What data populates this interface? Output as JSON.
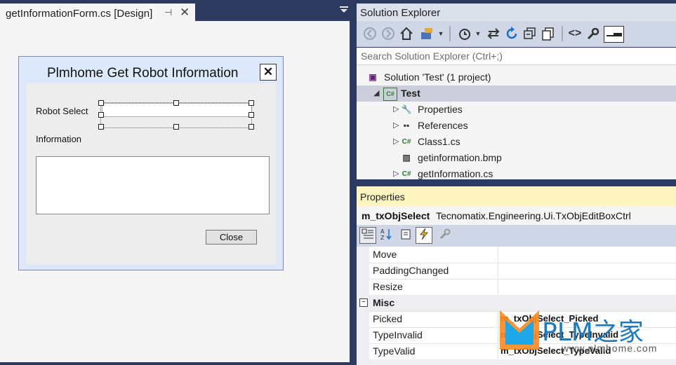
{
  "designer": {
    "tab_title": "getInformationForm.cs [Design]",
    "pin_glyph": "⊣",
    "close_glyph": "✕",
    "form": {
      "title": "Plmhome Get Robot Information",
      "close_glyph": "✕",
      "robot_select_label": "Robot Select",
      "information_label": "Information",
      "close_button": "Close"
    }
  },
  "solution_explorer": {
    "title": "Solution Explorer",
    "search_placeholder": "Search Solution Explorer (Ctrl+;)",
    "toolbar_icons": [
      "back-icon",
      "forward-icon",
      "home-icon",
      "sync-view-icon",
      "dropdown-icon",
      "pending-changes-icon",
      "dropdown-icon",
      "sync-icon",
      "refresh-icon",
      "collapse-all-icon",
      "show-all-files-icon",
      "view-code-icon",
      "properties-wrench-icon",
      "preview-icon"
    ],
    "tree": [
      {
        "label": "Solution 'Test' (1 project)",
        "icon": "solution-icon",
        "level": 0,
        "arrow": ""
      },
      {
        "label": "Test",
        "icon": "csharp-project-icon",
        "level": 1,
        "arrow": "expanded",
        "selected": true,
        "bold": true
      },
      {
        "label": "Properties",
        "icon": "wrench-icon",
        "level": 2,
        "arrow": "collapsed"
      },
      {
        "label": "References",
        "icon": "references-icon",
        "level": 2,
        "arrow": "collapsed"
      },
      {
        "label": "Class1.cs",
        "icon": "csharp-file-icon",
        "level": 2,
        "arrow": "collapsed"
      },
      {
        "label": "getinformation.bmp",
        "icon": "image-file-icon",
        "level": 2,
        "arrow": ""
      },
      {
        "label": "getInformation.cs",
        "icon": "csharp-file-icon",
        "level": 2,
        "arrow": "collapsed"
      }
    ]
  },
  "properties": {
    "title": "Properties",
    "object_name": "m_txObjSelect",
    "object_type": "Tecnomatix.Engineering.Ui.TxObjEditBoxCtrl",
    "rows": [
      {
        "kind": "prop",
        "name": "Move",
        "value": ""
      },
      {
        "kind": "prop",
        "name": "PaddingChanged",
        "value": ""
      },
      {
        "kind": "prop",
        "name": "Resize",
        "value": ""
      },
      {
        "kind": "category",
        "name": "Misc",
        "value": ""
      },
      {
        "kind": "prop",
        "name": "Picked",
        "value": "m_txObjSelect_Picked"
      },
      {
        "kind": "prop",
        "name": "TypeInvalid",
        "value": "m_txObjSelect_TypeInvalid"
      },
      {
        "kind": "prop",
        "name": "TypeValid",
        "value": "m_txObjSelect_TypeValid"
      }
    ]
  },
  "watermark": {
    "brand": "PLM之家",
    "url": "www.plmhome.com"
  },
  "colors": {
    "ide_frame": "#2b3a5e",
    "properties_header": "#fdf4bf",
    "form_caption": "#dde9fb",
    "selection": "#cccedb"
  }
}
